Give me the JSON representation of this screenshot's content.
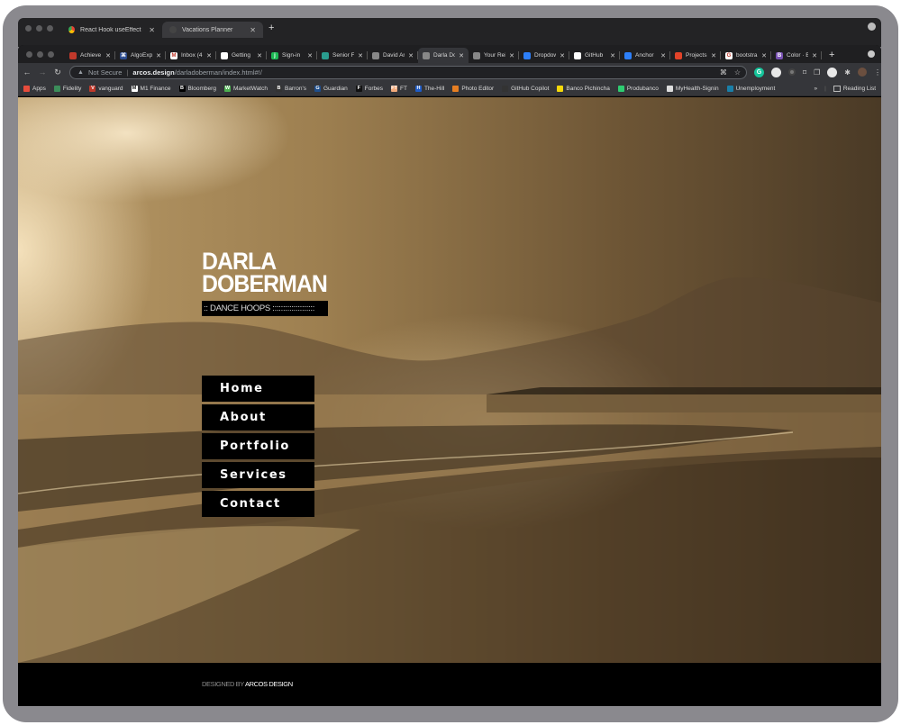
{
  "back_window": {
    "tabs": [
      {
        "label": "React Hook useEffect has mis",
        "icon": "chrome-globe-icon",
        "active": false
      },
      {
        "label": "Vacations Planner",
        "icon": "app-icon",
        "active": true
      }
    ]
  },
  "browser": {
    "tabs": [
      {
        "label": "Achieve",
        "icon_color": "#c0392b",
        "icon_char": ""
      },
      {
        "label": "AlgoExp",
        "icon_color": "#2c4b8e",
        "icon_char": "⌘"
      },
      {
        "label": "Inbox (4",
        "icon_color": "#ffffff",
        "icon_char": "M"
      },
      {
        "label": "Getting",
        "icon_color": "#ffffff",
        "icon_char": ""
      },
      {
        "label": "Sign-in",
        "icon_color": "#1db954",
        "icon_char": "j"
      },
      {
        "label": "Senior F",
        "icon_color": "#2a9d8f",
        "icon_char": ""
      },
      {
        "label": "David Ar",
        "icon_color": "#888888",
        "icon_char": ""
      },
      {
        "label": "Darla Do",
        "icon_color": "#888888",
        "icon_char": "",
        "active": true
      },
      {
        "label": "Your Rei",
        "icon_color": "#888888",
        "icon_char": ""
      },
      {
        "label": "Dropdow",
        "icon_color": "#2d7ff9",
        "icon_char": ""
      },
      {
        "label": "GitHub",
        "icon_color": "#ffffff",
        "icon_char": ""
      },
      {
        "label": "Anchor",
        "icon_color": "#2d7ff9",
        "icon_char": ""
      },
      {
        "label": "Projects",
        "icon_color": "#e24329",
        "icon_char": ""
      },
      {
        "label": "bootstra",
        "icon_color": "#ffffff",
        "icon_char": "G"
      },
      {
        "label": "Color · B",
        "icon_color": "#7952b3",
        "icon_char": "B"
      }
    ],
    "new_tab": "+",
    "security_label": "Not Secure",
    "url_host": "arcos.design",
    "url_path": "/darladoberman/index.html#!/",
    "bookmarks": [
      {
        "label": "Apps",
        "color": "#e74c3c"
      },
      {
        "label": "Fidelity",
        "color": "#3c8d5a"
      },
      {
        "label": "vanguard",
        "color": "#c0392b",
        "char": "V"
      },
      {
        "label": "M1 Finance",
        "color": "#ffffff",
        "char": "M"
      },
      {
        "label": "Bloomberg",
        "color": "#000000",
        "char": "B"
      },
      {
        "label": "MarketWatch",
        "color": "#4caf50",
        "char": "W"
      },
      {
        "label": "Barron's",
        "color": "#333333",
        "char": "B"
      },
      {
        "label": "Guardian",
        "color": "#1e4e8c",
        "char": "G"
      },
      {
        "label": "Forbes",
        "color": "#111111",
        "char": "F"
      },
      {
        "label": "FT",
        "color": "#f2a97a",
        "char": "FT"
      },
      {
        "label": "The-Hill",
        "color": "#1e5bc6",
        "char": "H"
      },
      {
        "label": "Photo Editor",
        "color": "#e67e22",
        "char": ""
      },
      {
        "label": "GitHub Copilot",
        "color": "#333333",
        "char": ""
      },
      {
        "label": "Banco Pichincha",
        "color": "#f5d90a",
        "char": ""
      },
      {
        "label": "Produbanco",
        "color": "#2ecc71",
        "char": ""
      },
      {
        "label": "MyHealth-Signin",
        "color": "#dddddd",
        "char": ""
      },
      {
        "label": "Unemployment",
        "color": "#1a7fa8",
        "char": ""
      }
    ],
    "bookmarks_overflow": "»",
    "reading_list": "Reading List"
  },
  "site": {
    "name_line1": "DARLA",
    "name_line2": "DOBERMAN",
    "tagline": ":: DANCE HOOPS ::::::::::::::::::::",
    "menu": [
      "Home",
      "About",
      "Portfolio",
      "Services",
      "Contact"
    ],
    "footer_prefix": "DESIGNED BY ",
    "footer_brand": "ARCOS DESIGN"
  }
}
